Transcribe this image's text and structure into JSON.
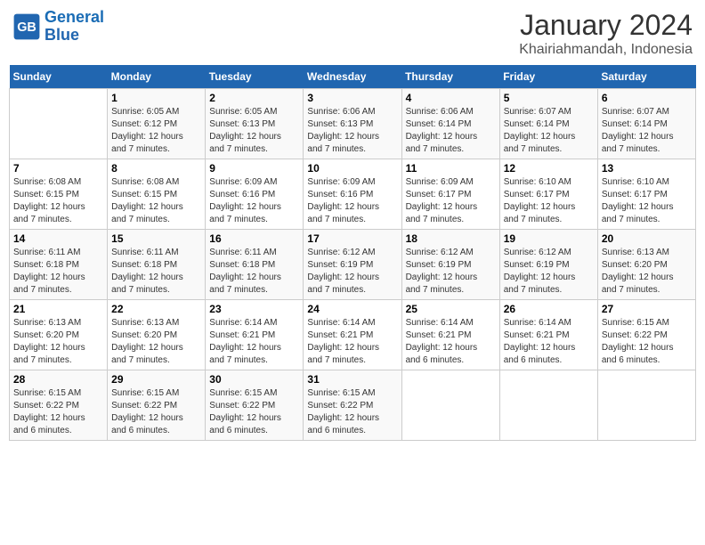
{
  "logo": {
    "text_general": "General",
    "text_blue": "Blue"
  },
  "title": "January 2024",
  "subtitle": "Khairiahmandah, Indonesia",
  "days_of_week": [
    "Sunday",
    "Monday",
    "Tuesday",
    "Wednesday",
    "Thursday",
    "Friday",
    "Saturday"
  ],
  "weeks": [
    [
      {
        "day": "",
        "info": ""
      },
      {
        "day": "1",
        "info": "Sunrise: 6:05 AM\nSunset: 6:12 PM\nDaylight: 12 hours\nand 7 minutes."
      },
      {
        "day": "2",
        "info": "Sunrise: 6:05 AM\nSunset: 6:13 PM\nDaylight: 12 hours\nand 7 minutes."
      },
      {
        "day": "3",
        "info": "Sunrise: 6:06 AM\nSunset: 6:13 PM\nDaylight: 12 hours\nand 7 minutes."
      },
      {
        "day": "4",
        "info": "Sunrise: 6:06 AM\nSunset: 6:14 PM\nDaylight: 12 hours\nand 7 minutes."
      },
      {
        "day": "5",
        "info": "Sunrise: 6:07 AM\nSunset: 6:14 PM\nDaylight: 12 hours\nand 7 minutes."
      },
      {
        "day": "6",
        "info": "Sunrise: 6:07 AM\nSunset: 6:14 PM\nDaylight: 12 hours\nand 7 minutes."
      }
    ],
    [
      {
        "day": "7",
        "info": "Sunrise: 6:08 AM\nSunset: 6:15 PM\nDaylight: 12 hours\nand 7 minutes."
      },
      {
        "day": "8",
        "info": "Sunrise: 6:08 AM\nSunset: 6:15 PM\nDaylight: 12 hours\nand 7 minutes."
      },
      {
        "day": "9",
        "info": "Sunrise: 6:09 AM\nSunset: 6:16 PM\nDaylight: 12 hours\nand 7 minutes."
      },
      {
        "day": "10",
        "info": "Sunrise: 6:09 AM\nSunset: 6:16 PM\nDaylight: 12 hours\nand 7 minutes."
      },
      {
        "day": "11",
        "info": "Sunrise: 6:09 AM\nSunset: 6:17 PM\nDaylight: 12 hours\nand 7 minutes."
      },
      {
        "day": "12",
        "info": "Sunrise: 6:10 AM\nSunset: 6:17 PM\nDaylight: 12 hours\nand 7 minutes."
      },
      {
        "day": "13",
        "info": "Sunrise: 6:10 AM\nSunset: 6:17 PM\nDaylight: 12 hours\nand 7 minutes."
      }
    ],
    [
      {
        "day": "14",
        "info": "Sunrise: 6:11 AM\nSunset: 6:18 PM\nDaylight: 12 hours\nand 7 minutes."
      },
      {
        "day": "15",
        "info": "Sunrise: 6:11 AM\nSunset: 6:18 PM\nDaylight: 12 hours\nand 7 minutes."
      },
      {
        "day": "16",
        "info": "Sunrise: 6:11 AM\nSunset: 6:18 PM\nDaylight: 12 hours\nand 7 minutes."
      },
      {
        "day": "17",
        "info": "Sunrise: 6:12 AM\nSunset: 6:19 PM\nDaylight: 12 hours\nand 7 minutes."
      },
      {
        "day": "18",
        "info": "Sunrise: 6:12 AM\nSunset: 6:19 PM\nDaylight: 12 hours\nand 7 minutes."
      },
      {
        "day": "19",
        "info": "Sunrise: 6:12 AM\nSunset: 6:19 PM\nDaylight: 12 hours\nand 7 minutes."
      },
      {
        "day": "20",
        "info": "Sunrise: 6:13 AM\nSunset: 6:20 PM\nDaylight: 12 hours\nand 7 minutes."
      }
    ],
    [
      {
        "day": "21",
        "info": "Sunrise: 6:13 AM\nSunset: 6:20 PM\nDaylight: 12 hours\nand 7 minutes."
      },
      {
        "day": "22",
        "info": "Sunrise: 6:13 AM\nSunset: 6:20 PM\nDaylight: 12 hours\nand 7 minutes."
      },
      {
        "day": "23",
        "info": "Sunrise: 6:14 AM\nSunset: 6:21 PM\nDaylight: 12 hours\nand 7 minutes."
      },
      {
        "day": "24",
        "info": "Sunrise: 6:14 AM\nSunset: 6:21 PM\nDaylight: 12 hours\nand 7 minutes."
      },
      {
        "day": "25",
        "info": "Sunrise: 6:14 AM\nSunset: 6:21 PM\nDaylight: 12 hours\nand 6 minutes."
      },
      {
        "day": "26",
        "info": "Sunrise: 6:14 AM\nSunset: 6:21 PM\nDaylight: 12 hours\nand 6 minutes."
      },
      {
        "day": "27",
        "info": "Sunrise: 6:15 AM\nSunset: 6:22 PM\nDaylight: 12 hours\nand 6 minutes."
      }
    ],
    [
      {
        "day": "28",
        "info": "Sunrise: 6:15 AM\nSunset: 6:22 PM\nDaylight: 12 hours\nand 6 minutes."
      },
      {
        "day": "29",
        "info": "Sunrise: 6:15 AM\nSunset: 6:22 PM\nDaylight: 12 hours\nand 6 minutes."
      },
      {
        "day": "30",
        "info": "Sunrise: 6:15 AM\nSunset: 6:22 PM\nDaylight: 12 hours\nand 6 minutes."
      },
      {
        "day": "31",
        "info": "Sunrise: 6:15 AM\nSunset: 6:22 PM\nDaylight: 12 hours\nand 6 minutes."
      },
      {
        "day": "",
        "info": ""
      },
      {
        "day": "",
        "info": ""
      },
      {
        "day": "",
        "info": ""
      }
    ]
  ]
}
